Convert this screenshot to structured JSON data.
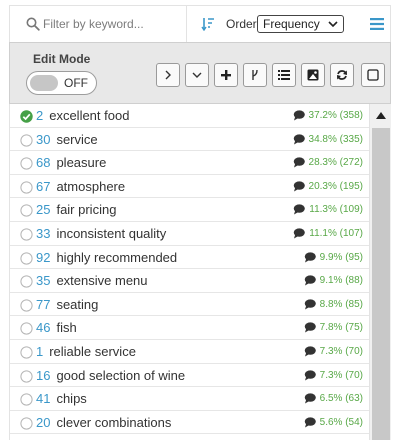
{
  "filter": {
    "placeholder": "Filter by keyword...",
    "icon": "search-icon"
  },
  "order": {
    "label": "Order:",
    "value": "Frequency",
    "icon": "sort-icon"
  },
  "menu": {
    "icon": "hamburger-menu-icon"
  },
  "toolbar": {
    "edit_mode_label": "Edit Mode",
    "toggle_text": "OFF",
    "buttons": [
      {
        "icon": "chevron-right-icon"
      },
      {
        "icon": "chevron-down-icon"
      },
      {
        "icon": "plus-icon"
      },
      {
        "icon": "merge-icon"
      },
      {
        "icon": "list-icon"
      },
      {
        "icon": "image-icon"
      },
      {
        "icon": "refresh-icon"
      },
      {
        "icon": "square-icon"
      }
    ]
  },
  "colors": {
    "accent": "#3a97c9",
    "percent": "#58a847",
    "checked": "#45a047"
  },
  "rows": [
    {
      "num": "2",
      "term": "excellent food",
      "pct": "37.2% (358)",
      "checked": true
    },
    {
      "num": "30",
      "term": "service",
      "pct": "34.8% (335)",
      "checked": false
    },
    {
      "num": "68",
      "term": "pleasure",
      "pct": "28.3% (272)",
      "checked": false
    },
    {
      "num": "67",
      "term": "atmosphere",
      "pct": "20.3% (195)",
      "checked": false
    },
    {
      "num": "25",
      "term": "fair pricing",
      "pct": "11.3% (109)",
      "checked": false
    },
    {
      "num": "33",
      "term": "inconsistent quality",
      "pct": "11.1% (107)",
      "checked": false
    },
    {
      "num": "92",
      "term": "highly recommended",
      "pct": "9.9% (95)",
      "checked": false
    },
    {
      "num": "35",
      "term": "extensive menu",
      "pct": "9.1% (88)",
      "checked": false
    },
    {
      "num": "77",
      "term": "seating",
      "pct": "8.8% (85)",
      "checked": false
    },
    {
      "num": "46",
      "term": "fish",
      "pct": "7.8% (75)",
      "checked": false
    },
    {
      "num": "1",
      "term": "reliable service",
      "pct": "7.3% (70)",
      "checked": false
    },
    {
      "num": "16",
      "term": "good selection of wine",
      "pct": "7.3% (70)",
      "checked": false
    },
    {
      "num": "41",
      "term": "chips",
      "pct": "6.5% (63)",
      "checked": false
    },
    {
      "num": "20",
      "term": "clever combinations",
      "pct": "5.6% (54)",
      "checked": false
    }
  ]
}
